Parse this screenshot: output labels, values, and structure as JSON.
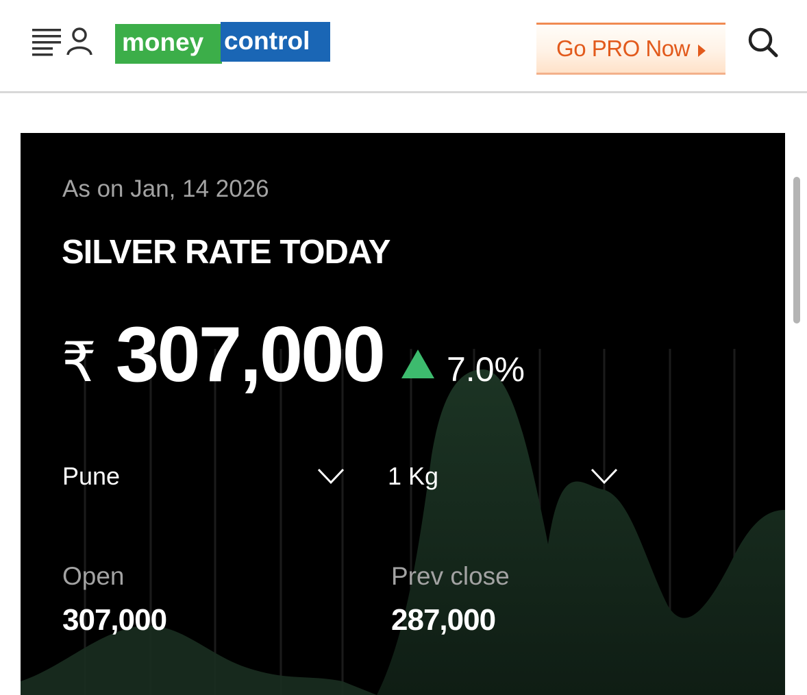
{
  "header": {
    "logo": {
      "part1": "money",
      "part2": "control",
      "color1": "#3cae49",
      "color2": "#1a66b5"
    },
    "pro_button": "Go PRO Now",
    "menu_icon": "menu-icon",
    "user_icon": "user-icon",
    "search_icon": "search-icon"
  },
  "rate": {
    "as_on": "As on Jan, 14 2026",
    "title": "SILVER RATE TODAY",
    "currency": "₹",
    "price": "307,000",
    "change": "7.0%",
    "change_direction": "up",
    "up_color": "#3dbb6e"
  },
  "filters": {
    "city": "Pune",
    "unit": "1 Kg"
  },
  "stats": {
    "open_label": "Open",
    "open_value": "307,000",
    "prev_close_label": "Prev close",
    "prev_close_value": "287,000"
  }
}
